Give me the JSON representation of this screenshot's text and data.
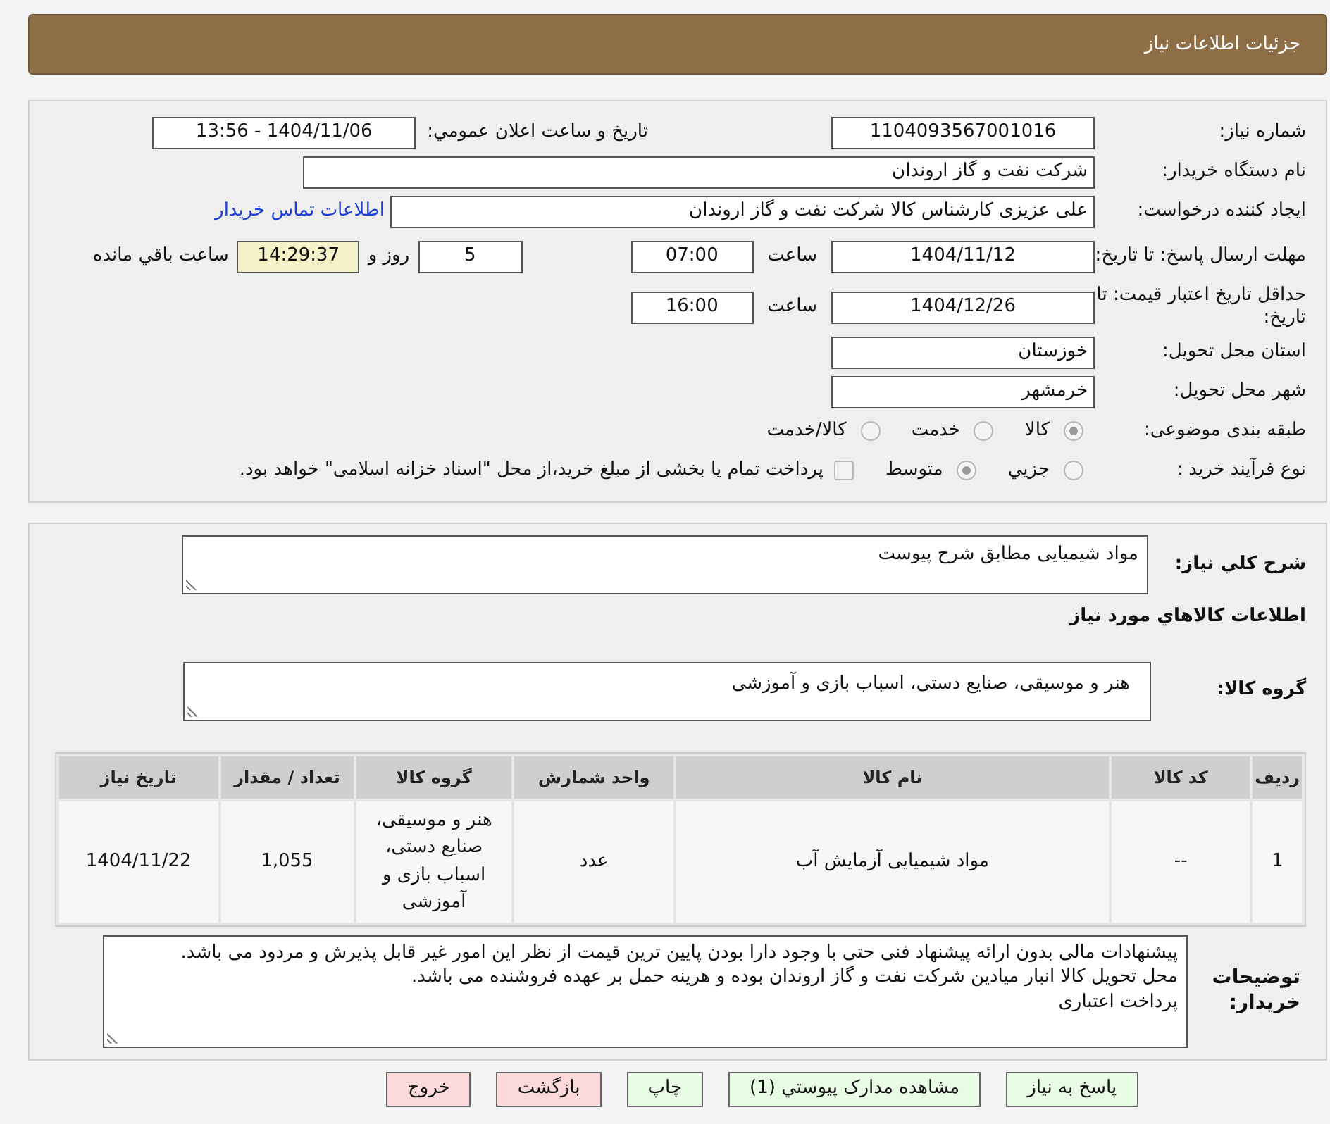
{
  "header": {
    "title": "جزئیات اطلاعات نیاز"
  },
  "need_number": {
    "label": "شماره نیاز:",
    "value": "1104093567001016"
  },
  "announce": {
    "label": "تاریخ و ساعت اعلان عمومي:",
    "value": "1404/11/06 - 13:56"
  },
  "buyer": {
    "label": "نام دستگاه خریدار:",
    "value": "شرکت نفت و گاز اروندان"
  },
  "requester": {
    "label": "ایجاد کننده درخواست:",
    "value": "علی عزیزی کارشناس کالا شرکت نفت و گاز اروندان",
    "link": "اطلاعات تماس خریدار"
  },
  "deadline": {
    "label": "مهلت ارسال پاسخ: تا تاریخ:",
    "date": "1404/11/12",
    "time_label": "ساعت",
    "time": "07:00",
    "days": "5",
    "days_label": "روز و",
    "remaining": "14:29:37",
    "remaining_label": "ساعت باقي مانده"
  },
  "validity": {
    "label": "حداقل تاریخ اعتبار قیمت: تا تاریخ:",
    "date": "1404/12/26",
    "time_label": "ساعت",
    "time": "16:00"
  },
  "province": {
    "label": "استان محل تحویل:",
    "value": "خوزستان"
  },
  "city": {
    "label": "شهر محل تحویل:",
    "value": "خرمشهر"
  },
  "category": {
    "label": "طبقه بندی موضوعی:",
    "options": [
      {
        "label": "کالا",
        "selected": true
      },
      {
        "label": "خدمت",
        "selected": false
      },
      {
        "label": "کالا/خدمت",
        "selected": false
      }
    ]
  },
  "process": {
    "label": "نوع فرآیند خرید :",
    "options": [
      {
        "label": "جزيي",
        "selected": false
      },
      {
        "label": "متوسط",
        "selected": true
      }
    ],
    "checkbox": {
      "label": "پرداخت تمام یا بخشی از مبلغ خرید،از محل \"اسناد خزانه اسلامی\" خواهد بود.",
      "checked": false
    }
  },
  "description": {
    "label": "شرح کلي نیاز:",
    "value": "مواد شیمیایی مطابق شرح پیوست"
  },
  "goods_heading": "اطلاعات کالاهاي مورد نیاز",
  "goods_group": {
    "label": "گروه کالا:",
    "value": "هنر و موسیقی، صنایع دستی، اسباب بازی و آموزشی"
  },
  "table": {
    "columns": [
      "ردیف",
      "کد کالا",
      "نام کالا",
      "واحد شمارش",
      "گروه کالا",
      "تعداد / مقدار",
      "تاریخ نیاز"
    ],
    "rows": [
      [
        "1",
        "--",
        "مواد شیمیایی آزمایش آب",
        "عدد",
        "هنر و موسیقی، صنایع دستی، اسباب بازی و آموزشی",
        "1,055",
        "1404/11/22"
      ]
    ]
  },
  "notes": {
    "label": "توضیحات خریدار:",
    "lines": [
      "پیشنهادات مالی بدون ارائه پیشنهاد فنی حتی با وجود دارا بودن پایین ترین قیمت از نظر این امور غیر قابل پذیرش و مردود می باشد.",
      "محل تحویل کالا انبار میادین شرکت نفت و گاز اروندان بوده و هرینه حمل بر عهده فروشنده می باشد.",
      "پرداخت اعتباری"
    ]
  },
  "buttons": [
    {
      "label": "پاسخ به نیاز",
      "kind": "primary"
    },
    {
      "label": "مشاهده مدارک پیوستي (1)",
      "kind": "primary"
    },
    {
      "label": "چاپ",
      "kind": "primary"
    },
    {
      "label": "بازگشت",
      "kind": "danger"
    },
    {
      "label": "خروج",
      "kind": "danger"
    }
  ]
}
